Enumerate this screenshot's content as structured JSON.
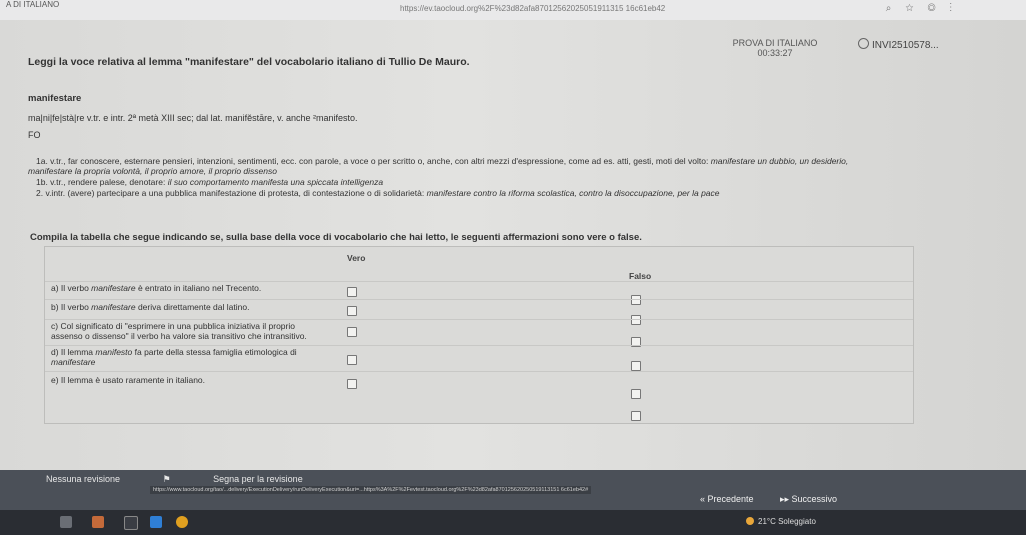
{
  "browser": {
    "tab_title": "A DI ITALIANO",
    "url": "https://ev.taocloud.org%2F%23d82afa87012562025051911315 16c61eb42"
  },
  "exam": {
    "title": "PROVA DI ITALIANO",
    "timer": "00:33:27",
    "user_id": "INVI2510578..."
  },
  "content": {
    "instruction": "Leggi la voce relativa al lemma \"manifestare\" del vocabolario italiano di Tullio De Mauro.",
    "lemma": "manifestare",
    "syllabification": "ma|ni|fe|stà|re v.tr. e intr. 2ª metà XIII sec; dal lat. manifĕstāre, v. anche ²manifesto.",
    "usage_mark": "FO",
    "def1a_text": "1a. v.tr., far conoscere, esternare pensieri, intenzioni, sentimenti, ecc. con parole, a voce o per scritto o, anche, con altri mezzi d'espressione, come ad es. atti, gesti, moti del volto: ",
    "def1a_example": "manifestare un dubbio, un desiderio,",
    "def1a_cont": "manifestare la propria volontà, il proprio amore, il proprio dissenso",
    "def1b_text": "1b. v.tr., rendere palese, denotare: ",
    "def1b_example": "il suo comportamento manifesta una spiccata intelligenza",
    "def2_text": "2. v.intr. (avere) partecipare a una pubblica manifestazione di protesta, di contestazione o di solidarietà: ",
    "def2_example": "manifestare contro la riforma scolastica, contro la disoccupazione, per la pace",
    "task": "Compila la tabella che segue indicando se, sulla base della voce di vocabolario che hai letto, le seguenti affermazioni sono vere o false."
  },
  "table": {
    "header_true": "Vero",
    "header_false": "Falso",
    "rows": [
      {
        "pre": "a) Il verbo ",
        "em": "manifestare",
        "post": " è entrato in italiano nel Trecento.",
        "line2": ""
      },
      {
        "pre": "b) Il verbo ",
        "em": "manifestare",
        "post": " deriva direttamente dal latino.",
        "line2": ""
      },
      {
        "pre": "c) Col significato di \"esprimere in una pubblica iniziativa il proprio",
        "em": "",
        "post": "",
        "line2": "assenso o dissenso\" il verbo ha valore sia transitivo che intransitivo."
      },
      {
        "pre": "d) Il lemma ",
        "em": "manifesto",
        "post": " fa parte della stessa famiglia etimologica di",
        "line2": "manifestare"
      },
      {
        "pre": "e) Il lemma è usato raramente in italiano.",
        "em": "",
        "post": "",
        "line2": ""
      }
    ]
  },
  "nav": {
    "review_label": "Nessuna revisione",
    "mark_label": "Segna per la revisione",
    "status_url": "https://www.taocloud.org/tao/...delivery/ExecutionDelivery/runDeliveryExecution&uri=...https%3A%2F%2Fevtest.taocloud.org%2F%23d82afa870125620250519113151 6c61eb42#",
    "prev_label": "Precedente",
    "next_label": "Successivo"
  },
  "taskbar": {
    "weather": "21°C Soleggiato"
  }
}
